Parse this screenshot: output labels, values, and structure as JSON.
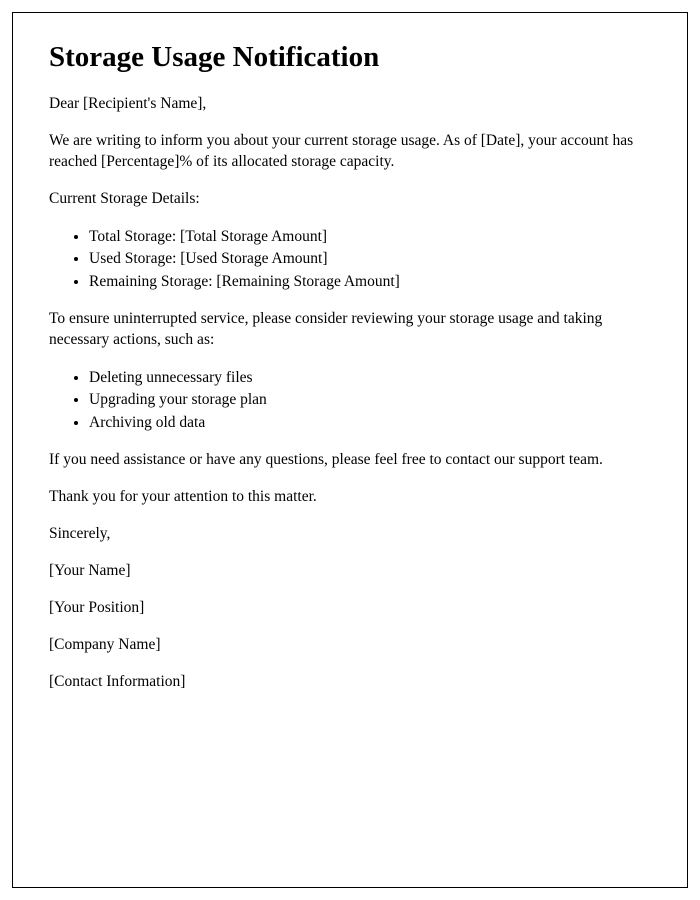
{
  "title": "Storage Usage Notification",
  "salutation": "Dear [Recipient's Name],",
  "intro": "We are writing to inform you about your current storage usage. As of [Date], your account has reached [Percentage]% of its allocated storage capacity.",
  "details_label": "Current Storage Details:",
  "details": [
    "Total Storage: [Total Storage Amount]",
    "Used Storage: [Used Storage Amount]",
    "Remaining Storage: [Remaining Storage Amount]"
  ],
  "actions_intro": "To ensure uninterrupted service, please consider reviewing your storage usage and taking necessary actions, such as:",
  "actions": [
    "Deleting unnecessary files",
    "Upgrading your storage plan",
    "Archiving old data"
  ],
  "support_line": "If you need assistance or have any questions, please feel free to contact our support team.",
  "thanks_line": "Thank you for your attention to this matter.",
  "signoff": "Sincerely,",
  "signature": {
    "name": "[Your Name]",
    "position": "[Your Position]",
    "company": "[Company Name]",
    "contact": "[Contact Information]"
  }
}
